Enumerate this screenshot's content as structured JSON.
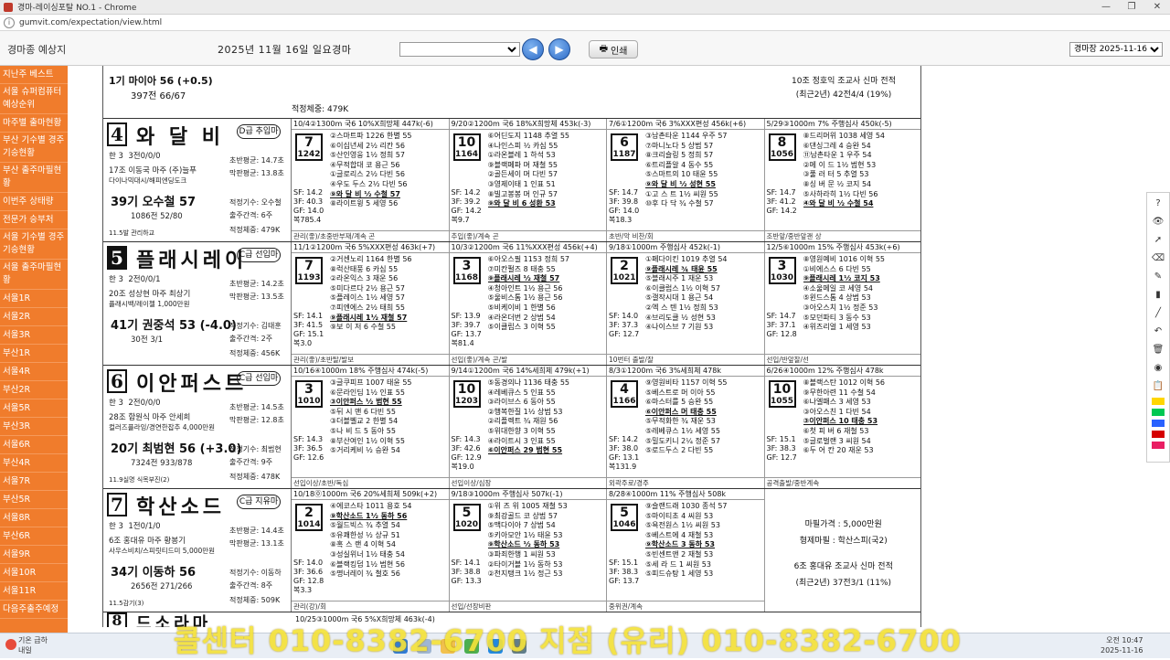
{
  "window": {
    "title": "경마-레이싱포탈 NO.1 - Chrome",
    "url": "gumvit.com/expectation/view.html"
  },
  "toolbar": {
    "app_title": "경마종 예상지",
    "race_date": "2025년 11월 16일 일요경마",
    "print_label": "인쇄",
    "date_select": "경마장 2025-11-16"
  },
  "sidebar": {
    "items": [
      "지난주 베스트",
      "서울 슈퍼컴퓨터 예상순위",
      "마주별 출마현황",
      "부산 기수별 경주 기승현황",
      "부산 출주마필현황",
      "이번주 상태량",
      "전문가 승부처",
      "서울 기수별 경주 기승현황",
      "서울 출주마필현황",
      "서울1R",
      "서울2R",
      "서울3R",
      "부산1R",
      "서울4R",
      "부산2R",
      "서울5R",
      "부산3R",
      "서울6R",
      "부산4R",
      "서울7R",
      "부산5R",
      "서울8R",
      "부산6R",
      "서울9R",
      "서울10R",
      "서울11R",
      "다음주출주예정"
    ]
  },
  "top_strip": {
    "mini_horse": "1기 마이아 56 (+0.5)",
    "mini_stats": "397전 66/67",
    "note": [
      "10조 정호익 조교사 신마 전적",
      "(최근2년) 42전4/4 (19%)"
    ],
    "statline": "적정체중: 479K"
  },
  "entries": [
    {
      "num": "4",
      "name": "와 달 비",
      "grade": "D급 추입마",
      "inverted": false,
      "info1": "한 3",
      "info2": "3전0/0/0",
      "owner": "17조 이동국 마주 (주)늘푸",
      "owner2": "다이나믹대시/해피엔딩도크",
      "jockey": "39기 오수철 57",
      "jstats": "1086전 52/80",
      "trainer_line": "11.5발 관리하교",
      "mid": [
        "초반평균: 14.7초",
        "막판평균: 13.8초",
        "적정기수: 오수철",
        "출주간격: 6주",
        "적정체중: 479K"
      ],
      "races": [
        {
          "head": "10/4②1300m 국6 10%X희망체 447k(-6)",
          "rank": "7",
          "sub": "1242",
          "runners": [
            "②스마트파 1226 한별 55",
            "⑥이십년세 2½ 리칸 56",
            "⑤산인영웅 1½ 정희 57",
            "④무적합대 코 용근 56",
            "①글로리스 2½ 다빈 56",
            "④우도 두스 2½ 다빈 56",
            "⑨와 달 비 ½ 수철 57",
            "⑧라이트윙 5 세영 56"
          ],
          "sf": [
            "SF: 14.2",
            "3F: 40.3",
            "GF: 14.0",
            "복785.4"
          ],
          "foot": "관리(좋)/초중반부재/계속 곤"
        },
        {
          "head": "9/20②1200m 국6 18%X희망체 453k(-3)",
          "rank": "10",
          "sub": "1164",
          "runners": [
            "⑥어딘도지 1148 추열 55",
            "④나인스피 ½ 카심 55",
            "①라온블레 1 하석 53",
            "⑨블랙페파 머 재철 55",
            "②골든세이 머 다빈 57",
            "③영제이태 1 인표 51",
            "⑧빌고봉봉 머 인규 57",
            "⑨와 달 비 6 성환 53"
          ],
          "sf": [
            "SF: 14.2",
            "3F: 39.2",
            "GF: 14.2",
            "복9.7"
          ],
          "foot": "추입(좋)/계속 곤"
        },
        {
          "head": "7/6①1200m 국6 3%XXX편성 456k(+6)",
          "rank": "6",
          "sub": "1187",
          "runners": [
            "③남촌타운 1144 우주 57",
            "⑦마니노다 5 상범 57",
            "⑧크리슬링 5 정희 57",
            "⑥트리플알 4 동수 55",
            "⑤스마트의 10 태윤 55",
            "⑨와 달 비 ½ 성현 55",
            "①고 스 트 1½ 씨원 55",
            "⑩후 다 닥 ¾ 수철 57"
          ],
          "sf": [
            "SF: 14.7",
            "3F: 39.8",
            "GF: 14.0",
            "복18.3"
          ],
          "foot": "초반/악 비찬/회"
        },
        {
          "head": "5/29③1000m 7% 주행심사 450k(-5)",
          "rank": "8",
          "sub": "1056",
          "runners": [
            "⑧드리머위 1038 세영 54",
            "⑥댄싱그레 4 승완 54",
            "⑪남촌타운 1 우주 54",
            "②메 이 드 1½ 범현 53",
            "③풀 러 터 5 추열 53",
            "⑧싱 버 문 ½ 코지 54",
            "⑤사하라히 1½ 다빈 56",
            "④와 달 비 ½ 수철 54"
          ],
          "sf": [
            "SF: 14.7",
            "3F: 41.2",
            "GF: 14.2",
            ""
          ],
          "foot": "조반앞/중반앞괜 상"
        }
      ]
    },
    {
      "num": "5",
      "name": "플래시레이",
      "grade": "C급 선입마",
      "inverted": true,
      "info1": "한 3",
      "info2": "2전0/0/1",
      "owner": "20조 성상현 마주 최상기",
      "owner2": "플래시백/레이첼 1,000만원",
      "jockey": "41기 권중석 53 (-4.0)",
      "jstats": "30전 3/1",
      "trainer_line": "",
      "mid": [
        "초반평균: 14.2초",
        "막판평균: 13.5초",
        "적정기수: 김태훈",
        "출주간격: 2주",
        "적정체중: 456K"
      ],
      "races": [
        {
          "head": "11/1②1200m 국6 5%XXX편성 463k(+7)",
          "rank": "7",
          "sub": "1193",
          "runners": [
            "②거센노리 1164 한별 56",
            "⑧럭산태풍 6 카심 55",
            "②라온익스 3 재운 56",
            "⑤미다르다 2½ 용근 57",
            "⑤플레이스 1½ 세영 57",
            "⑦피엔에스 2½ 태희 55",
            "⑨플래시레 1½ 재철 57",
            "⑨보 이 저 6 수철 55"
          ],
          "sf": [
            "SF: 14.1",
            "3F: 41.5",
            "GF: 15.1",
            "복3.0"
          ],
          "foot": "관리(좋)/초반탈/발보"
        },
        {
          "head": "10/3②1200m 국6 11%XXX편성 456k(+4)",
          "rank": "3",
          "sub": "1168",
          "runners": [
            "⑥아오스필 1153 정희 57",
            "⑦미칸펄즈 8 태충 55",
            "⑨플래시레 ½ 재철 57",
            "④청아인트 1½ 용근 56",
            "⑤울비스톰 1½ 용근 56",
            "⑤비케이비 1 한별 56",
            "④라온더번 2 상범 54",
            "⑤이클립스 3 이혁 55"
          ],
          "sf": [
            "SF: 13.9",
            "3F: 39.7",
            "GF: 13.7",
            "복81.4"
          ],
          "foot": "선입(좋)/계속 곤/발"
        },
        {
          "head": "9/18①1000m 주행심사 452k(-1)",
          "rank": "2",
          "sub": "1021",
          "runners": [
            "①페다이킨 1019 추열 54",
            "⑨플래시레 ¾ 태윤 55",
            "⑤블래시주 1 재운 53",
            "⑥이클럽스 1½ 이혁 57",
            "⑤갤작시대 1 용근 54",
            "②엑 스 텐 1½ 정희 53",
            "④브리도클 ½ 성현 53",
            "④나이스브 7 기원 53"
          ],
          "sf": [
            "SF: 14.0",
            "3F: 37.3",
            "GF: 12.7",
            ""
          ],
          "foot": "10번터 출발/잘"
        },
        {
          "head": "12/5⑥1000m 15% 주행심사 453k(+6)",
          "rank": "3",
          "sub": "1030",
          "runners": [
            "⑧영원예비 1016 이혁 55",
            "①비에스스 6 다빈 55",
            "⑨플래시레 1½ 코지 53",
            "④소울메일 코 세영 54",
            "⑤윈드스톰 4 상범 53",
            "③아오스치 1½ 정준 53",
            "⑤모던파티 3 동수 53",
            "④위즈리얼 1 세영 53"
          ],
          "sf": [
            "SF: 14.7",
            "3F: 37.1",
            "GF: 12.8",
            ""
          ],
          "foot": "선입/반앞잘/선"
        }
      ]
    },
    {
      "num": "6",
      "name": "이안퍼스트",
      "grade": "C급 선입마",
      "inverted": false,
      "info1": "한 3",
      "info2": "2전0/0/0",
      "owner": "28조 함원식 마주 안세희",
      "owner2": "컬러즈플라잉/경연한잡추 4,000만원",
      "jockey": "20기 최범현 56 (+3.0)",
      "jstats": "7324전 933/878",
      "trainer_line": "11.9실명 식목부진(2)",
      "mid": [
        "초반평균: 14.5초",
        "막판평균: 12.8초",
        "적정기수: 최범현",
        "출주간격: 9주",
        "적정체중: 478K"
      ],
      "races": [
        {
          "head": "10/16④1000m 18% 주행심사 474k(-5)",
          "rank": "3",
          "sub": "1010",
          "runners": [
            "③글쿠피프 1007 태윤 55",
            "⑥문라인딤 1½ 인표 55",
            "③이안퍼스 ½ 범현 55",
            "⑤뒤 시 맨 6 다빈 55",
            "③더블벨교 2 한별 54",
            "⑤나 비 드 5 동아 55",
            "⑧부산여인 1½ 이혁 55",
            "⑤거리케비 ½ 승완 54"
          ],
          "sf": [
            "SF: 14.3",
            "3F: 36.5",
            "GF: 12.6",
            ""
          ],
          "foot": "선입이상/초반/독심"
        },
        {
          "head": "9/14①1200m 국6 14%세희체 479k(+1)",
          "rank": "10",
          "sub": "1203",
          "runners": [
            "⑤동경의나 1136 태충 55",
            "④레베큐스 5 인표 55",
            "③라이브스 6 동아 55",
            "②행복한질 1½ 상범 53",
            "②리플렉트 ¾ 재원 56",
            "⑤위대한향 3 이혁 55",
            "④라이트시 3 인표 55",
            "⑥이안퍼스 29 범현 55"
          ],
          "sf": [
            "SF: 14.3",
            "3F: 42.6",
            "GF: 12.9",
            "복19.0"
          ],
          "foot": "선입이상/심장"
        },
        {
          "head": "8/3①1200m 국6 3%세희체 478k",
          "rank": "4",
          "sub": "1166",
          "runners": [
            "⑨영원비타 1157 이혁 55",
            "⑤베스트로 머 이아 55",
            "⑥마스터를 5 승완 55",
            "⑥이안퍼스 머 태충 55",
            "⑤무적화한 ¾ 재운 53",
            "⑤레베큐스 1½ 세영 55",
            "⑤밀도키니 2¼ 정준 57",
            "⑤로드두스 2 다빈 55"
          ],
          "sf": [
            "SF: 14.2",
            "3F: 38.0",
            "GF: 13.1",
            "복131.9"
          ],
          "foot": "외곽주로/경주"
        },
        {
          "head": "6/26④1000m 12% 주행심사 478k",
          "rank": "10",
          "sub": "1055",
          "runners": [
            "⑧블랙스탄 1012 이혁 56",
            "⑨무한아련 11 수철 54",
            "⑥나엘패스 3 세영 53",
            "③아오스친 1 다빈 54",
            "③이안퍼스 10 태충 53",
            "⑥첫 피 버 6 재철 53",
            "⑤글로벌랜 3 씨원 54",
            "⑥두 어 칸 20 재운 53"
          ],
          "sf": [
            "SF: 15.1",
            "3F: 38.3",
            "GF: 12.7",
            ""
          ],
          "foot": "공격출발/중반계속"
        }
      ]
    },
    {
      "num": "7",
      "name": "학산소드",
      "grade": "C급 지유마",
      "inverted": false,
      "info1": "한 3",
      "info2": "1전0/1/0",
      "owner": "6조 홍대유 마주 황봉기",
      "owner2": "사우스비치/스피릿티드미 5,000만원",
      "jockey": "34기 이동하 56",
      "jstats": "2656전 271/266",
      "trainer_line": "11.5감기(3)",
      "mid": [
        "초반평균: 14.4초",
        "막판평균: 13.1초",
        "적정기수: 이동하",
        "출주간격: 8주",
        "적정체중: 509K"
      ],
      "races": [
        {
          "head": "10/18⓪1000m 국6 20%세희체 509k(+2)",
          "rank": "2",
          "sub": "1014",
          "runners": [
            "④에코스타 1011 용호 54",
            "⑨학산소드 1½ 동하 56",
            "⑤월드빅스 ¾ 추열 54",
            "⑤유쾌한성 ½ 상규 51",
            "⑧혹 스 랜 4 이혁 54",
            "③성실위너 1½ 태충 54",
            "⑥블랙킹덤 1½ 범현 56",
            "⑤명너레이 ¾ 철호 56"
          ],
          "sf": [
            "SF: 14.0",
            "3F: 36.6",
            "GF: 12.8",
            "복3.3"
          ],
          "foot": "관리(강)/회"
        },
        {
          "head": "9/18③1000m 주행심사 507k(-1)",
          "rank": "5",
          "sub": "1020",
          "runners": [
            "①위 즈 위 1005 재철 53",
            "⑨최강골드 코 상범 57",
            "⑤맥다이아 7 상범 54",
            "⑤키아모안 1½ 태윤 53",
            "⑨학산소드 ½ 동하 53",
            "③파죄한행 1 씨원 53",
            "②타이거블 1½ 동하 53",
            "②천지탱크 1½ 정근 53"
          ],
          "sf": [
            "SF: 14.1",
            "3F: 38.8",
            "GF: 13.3",
            ""
          ],
          "foot": "선입/선장비판"
        },
        {
          "head": "8/28④1000m 11% 주행심사 508k",
          "rank": "5",
          "sub": "1046",
          "runners": [
            "⑨슬랜드래 1030 종석 57",
            "⑤마이티초 4 씨원 53",
            "⑤욕전원스 1½ 씨원 53",
            "⑤베스트에 4 재철 53",
            "⑨학산소드 3 동하 53",
            "⑤빈센트앤 2 재철 53",
            "⑤세 라 드 1 씨원 53",
            "⑤피드슈탕 1 세영 53"
          ],
          "sf": [
            "SF: 15.1",
            "3F: 38.3",
            "GF: 13.7",
            ""
          ],
          "foot": "중위권/계속"
        },
        {
          "head": "",
          "rank": "",
          "sub": "",
          "runners": [],
          "sf": [],
          "foot": ""
        }
      ],
      "note": [
        "마필가격 : 5,000만원",
        "형제마필 : 학산스피(국2)",
        "",
        "6조 홍대유 조교사 신마 전적",
        "(최근2년) 37전3/1 (11%)"
      ]
    }
  ],
  "next_entry": {
    "num": "8",
    "name": "드소라마",
    "head": "10/25③1000m 국6 5%X희망체 463k(-4)"
  },
  "tools": {
    "icons": [
      "help-icon",
      "eye-icon",
      "cursor-icon",
      "eraser-icon",
      "pen-icon",
      "marker-icon",
      "line-icon",
      "undo-icon",
      "trash-icon",
      "camera-icon",
      "clipboard-icon"
    ]
  },
  "taskbar": {
    "weather": [
      "기온 급하",
      "내일"
    ],
    "clock": [
      "오전 10:47",
      "2025-11-16"
    ],
    "overlay": "콜센터 010-8382-6700   지점 (유리) 010-8382-6700"
  }
}
